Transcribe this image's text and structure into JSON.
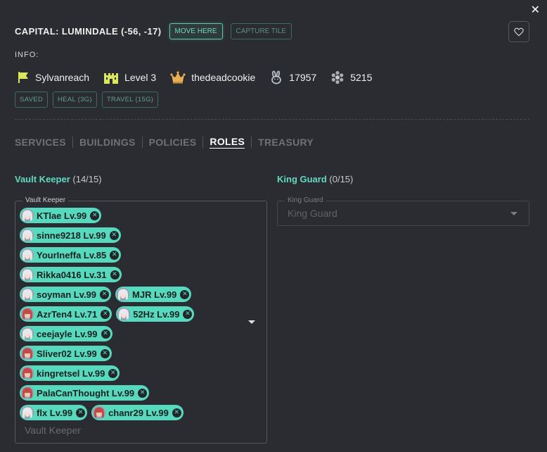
{
  "close_label": "✕",
  "header": {
    "title": "CAPITAL: LUMINDALE (-56, -17)",
    "move_here": "MOVE HERE",
    "capture_tile": "CAPTURE TILE"
  },
  "info": {
    "label": "INFO:",
    "kingdom": "Sylvanreach",
    "level": "Level 3",
    "owner": "thedeadcookie",
    "stat1": "17957",
    "stat2": "5215"
  },
  "tags": [
    "SAVED",
    "HEAL (3G)",
    "TRAVEL (15G)"
  ],
  "tabs": [
    {
      "label": "SERVICES",
      "active": false
    },
    {
      "label": "BUILDINGS",
      "active": false
    },
    {
      "label": "POLICIES",
      "active": false
    },
    {
      "label": "ROLES",
      "active": true
    },
    {
      "label": "TREASURY",
      "active": false
    }
  ],
  "vault_keeper": {
    "name": "Vault Keeper",
    "count": "(14/15)",
    "legend": "Vault Keeper",
    "placeholder": "Vault Keeper",
    "rows": [
      [
        {
          "label": "KTlae Lv.99",
          "avatar": "white"
        }
      ],
      [
        {
          "label": "sinne9218 Lv.99",
          "avatar": "white"
        }
      ],
      [
        {
          "label": "YourIneffa Lv.85",
          "avatar": "white"
        }
      ],
      [
        {
          "label": "Rikka0416 Lv.31",
          "avatar": "white"
        }
      ],
      [
        {
          "label": "soyman Lv.99",
          "avatar": "white"
        },
        {
          "label": "MJR Lv.99",
          "avatar": "white"
        }
      ],
      [
        {
          "label": "AzrTen4 Lv.71",
          "avatar": "red"
        },
        {
          "label": "52Hz Lv.99",
          "avatar": "white"
        }
      ],
      [
        {
          "label": "ceejayle Lv.99",
          "avatar": "white"
        }
      ],
      [
        {
          "label": "Sliver02 Lv.99",
          "avatar": "red"
        }
      ],
      [
        {
          "label": "kingretsel Lv.99",
          "avatar": "red"
        }
      ],
      [
        {
          "label": "PalaCanThought Lv.99",
          "avatar": "red"
        }
      ],
      [
        {
          "label": "flx Lv.99",
          "avatar": "white"
        },
        {
          "label": "chanr29 Lv.99",
          "avatar": "red"
        }
      ]
    ]
  },
  "king_guard": {
    "name": "King Guard",
    "count": "(0/15)",
    "legend": "King Guard",
    "placeholder": "King Guard"
  },
  "colors": {
    "accent": "#57d9be",
    "background": "#2a2c31"
  }
}
